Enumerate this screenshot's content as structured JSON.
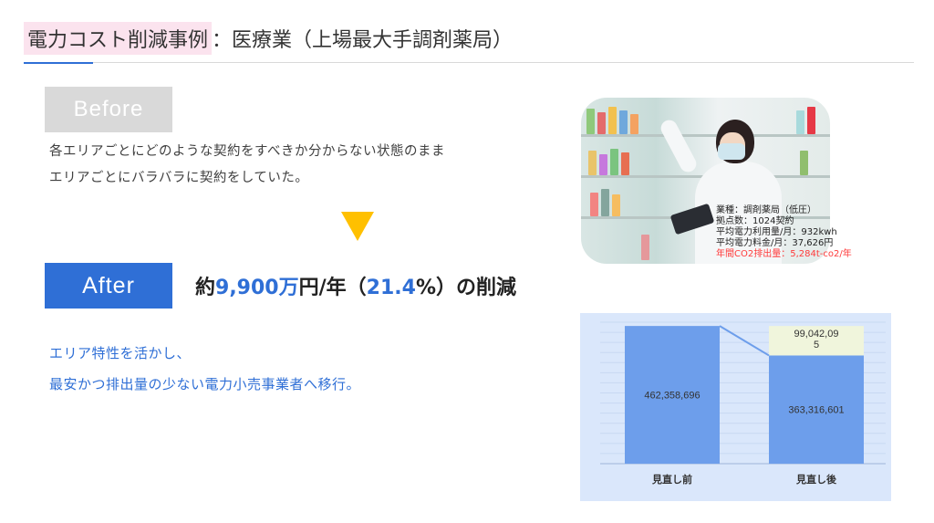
{
  "header": {
    "title_highlight": "電力コスト削減事例",
    "title_rest": "：医療業（上場最大手調剤薬局）"
  },
  "before": {
    "tag": "Before",
    "line1": "各エリアごとにどのような契約をすべきか分からない状態のまま",
    "line2": "エリアごとにバラバラに契約をしていた。"
  },
  "after": {
    "tag": "After",
    "result_prefix": "約",
    "result_amount": "9,900万",
    "result_unit": "円/年（",
    "result_percent": "21.4",
    "result_suffix": "%）の削減",
    "line1": "エリア特性を活かし、",
    "line2": "最安かつ排出量の少ない電力小売事業者へ移行。"
  },
  "photo_info": {
    "line1": "業種：調剤薬局（低圧）",
    "line2": "拠点数：1024契約",
    "line3": "平均電力利用量/月：932kwh",
    "line4": "平均電力料金/月：37,626円",
    "line5": "年間CO2排出量：5,284t-co2/年"
  },
  "colors": {
    "accent_blue": "#2f6fd6",
    "before_gray": "#d9d9d9",
    "arrow_yellow": "#ffc000",
    "title_highlight_bg": "#fbe3ee",
    "bar_blue": "#6d9eeb",
    "saving_fill": "#f0f5dc",
    "co2_red": "#ff3b3b"
  },
  "chart_data": {
    "type": "bar",
    "stacked": true,
    "categories": [
      "見直し前",
      "見直し後"
    ],
    "series": [
      {
        "values": [
          462358696,
          363316601
        ],
        "labels": [
          "462,358,696",
          "363,316,601"
        ]
      },
      {
        "values": [
          0,
          99042095
        ],
        "labels": [
          "",
          "99,042,09\n5"
        ]
      }
    ],
    "ylim": [
      0,
      475000000
    ],
    "grid": true,
    "legend": "none"
  }
}
